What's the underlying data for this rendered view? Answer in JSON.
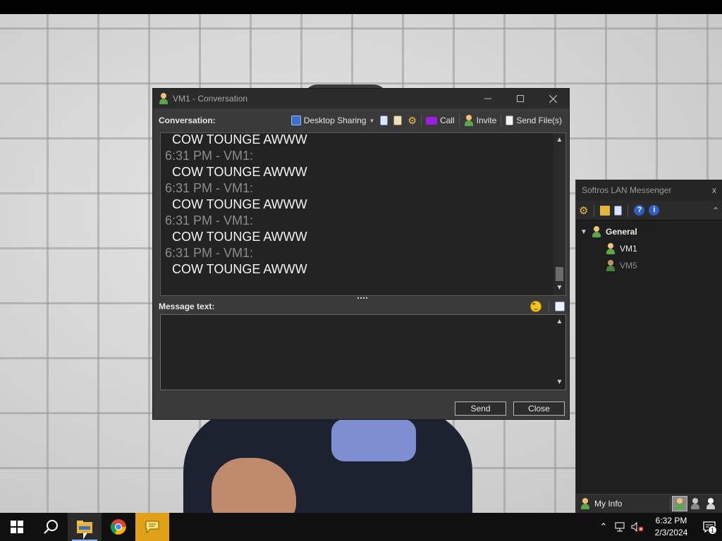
{
  "conversation": {
    "title": "VM1 - Conversation",
    "toolbar": {
      "label": "Conversation:",
      "desktop_sharing": "Desktop Sharing",
      "call": "Call",
      "invite": "Invite",
      "send_files": "Send File(s)"
    },
    "messages": [
      {
        "time_sender": "",
        "text": "COW TOUNGE AWWW"
      },
      {
        "time_sender": "6:31 PM - VM1:",
        "text": "COW TOUNGE AWWW"
      },
      {
        "time_sender": "6:31 PM - VM1:",
        "text": "COW TOUNGE AWWW"
      },
      {
        "time_sender": "6:31 PM - VM1:",
        "text": "COW TOUNGE AWWW"
      },
      {
        "time_sender": "6:31 PM - VM1:",
        "text": "COW TOUNGE AWWW"
      }
    ],
    "message_label": "Message text:",
    "message_value": "",
    "send_label": "Send",
    "close_label": "Close"
  },
  "lan": {
    "title": "Softros LAN Messenger",
    "close_glyph": "x",
    "group": "General",
    "users": [
      {
        "name": "VM1",
        "status": "online"
      },
      {
        "name": "VM5",
        "status": "offline"
      }
    ],
    "my_info": "My Info"
  },
  "taskbar": {
    "time": "6:32 PM",
    "date": "2/3/2024",
    "notification_count": "1"
  },
  "colors": {
    "window_bg": "#3a3a3a",
    "titlebar_bg": "#2b2b2b",
    "text_area_bg": "#232323",
    "timestamp": "#8c8c8c",
    "lan_taskbar_accent": "#e0a018"
  }
}
